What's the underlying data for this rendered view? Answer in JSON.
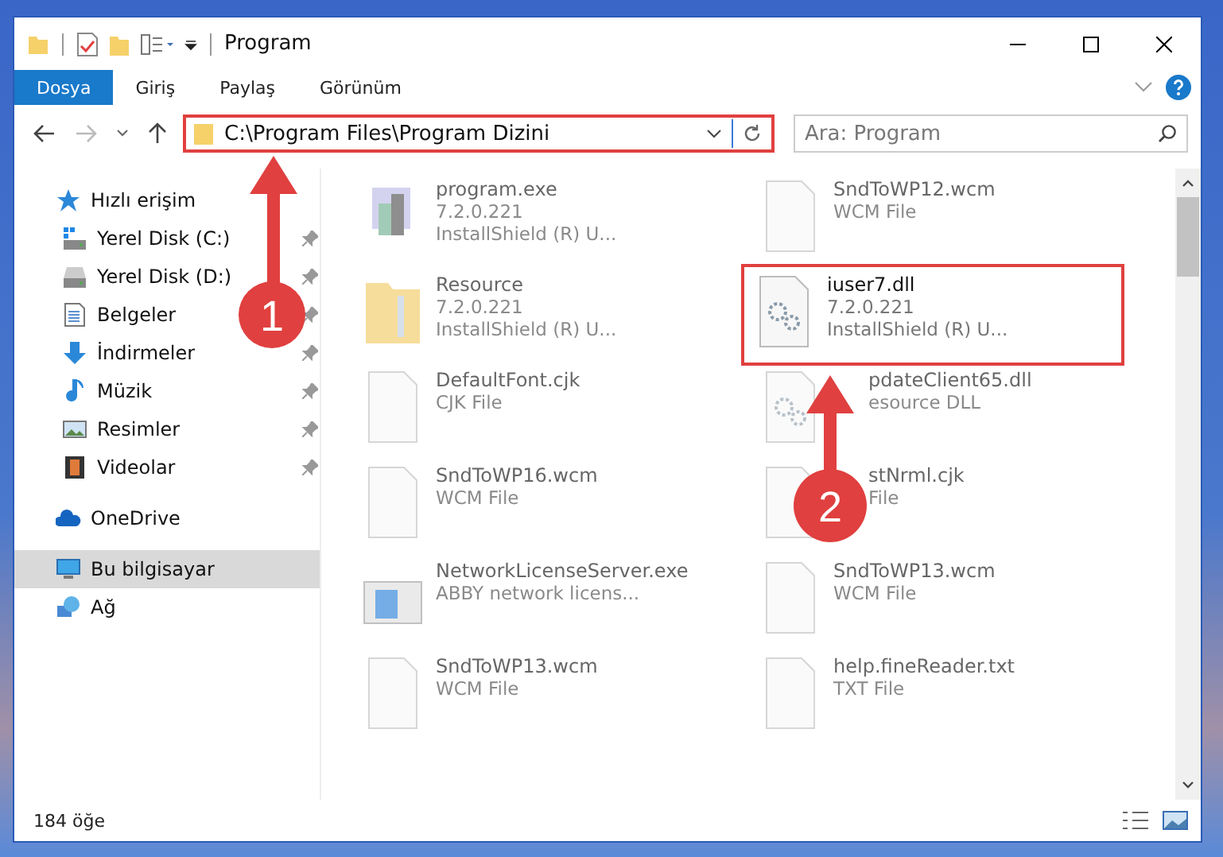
{
  "window": {
    "title": "Program"
  },
  "ribbon_tabs": [
    {
      "label": "Dosya",
      "selected": true
    },
    {
      "label": "Giriş",
      "selected": false
    },
    {
      "label": "Paylaş",
      "selected": false
    },
    {
      "label": "Görünüm",
      "selected": false
    }
  ],
  "address": {
    "path": "C:\\Program Files\\Program Dizini",
    "highlighted": true
  },
  "search": {
    "placeholder": "Ara: Program"
  },
  "sidebar": {
    "items": [
      {
        "label": "Hızlı erişim",
        "kind": "star",
        "selected": false,
        "children": [
          {
            "label": "Yerel Disk (C:)",
            "kind": "drive-c",
            "pinned": true,
            "selected": false
          },
          {
            "label": "Yerel Disk (D:)",
            "kind": "drive",
            "pinned": true,
            "selected": false
          },
          {
            "label": "Belgeler",
            "kind": "document",
            "pinned": true,
            "selected": false
          },
          {
            "label": "İndirmeler",
            "kind": "download",
            "pinned": true,
            "selected": false
          },
          {
            "label": "Müzik",
            "kind": "music",
            "pinned": true,
            "selected": false
          },
          {
            "label": "Resimler",
            "kind": "pictures",
            "pinned": true,
            "selected": false
          },
          {
            "label": "Videolar",
            "kind": "video",
            "pinned": true,
            "selected": false
          }
        ]
      },
      {
        "label": "OneDrive",
        "kind": "cloud",
        "selected": false
      },
      {
        "label": "Bu bilgisayar",
        "kind": "computer",
        "selected": true
      },
      {
        "label": "Ağ",
        "kind": "network",
        "selected": false
      }
    ]
  },
  "files": [
    {
      "name": "program.exe",
      "details": [
        "7.2.0.221",
        "InstallShield (R) U..."
      ],
      "kind": "exe",
      "highlighted": false
    },
    {
      "name": "SndToWP12.wcm",
      "details": [
        "WCM File"
      ],
      "kind": "file",
      "highlighted": false
    },
    {
      "name": "Resource",
      "details": [
        "7.2.0.221",
        "InstallShield (R) U..."
      ],
      "kind": "folder",
      "highlighted": false
    },
    {
      "name": "iuser7.dll",
      "details": [
        "7.2.0.221",
        "InstallShield (R) U..."
      ],
      "kind": "gear",
      "highlighted": true
    },
    {
      "name": "DefaultFont.cjk",
      "details": [
        "CJK File"
      ],
      "kind": "file",
      "highlighted": false
    },
    {
      "name": "pdateClient65.dll",
      "details": [
        "esource DLL"
      ],
      "kind": "dll",
      "highlighted": false,
      "covered": true
    },
    {
      "name": "SndToWP16.wcm",
      "details": [
        "WCM File"
      ],
      "kind": "file",
      "highlighted": false
    },
    {
      "name": "stNrml.cjk",
      "details": [
        "File"
      ],
      "kind": "file",
      "highlighted": false,
      "covered": true
    },
    {
      "name": "NetworkLicenseServer.exe",
      "details": [
        "ABBY network licens..."
      ],
      "kind": "app",
      "highlighted": false
    },
    {
      "name": "SndToWP13.wcm",
      "details": [
        "WCM File"
      ],
      "kind": "file",
      "highlighted": false
    },
    {
      "name": "SndToWP13.wcm",
      "details": [
        "WCM File"
      ],
      "kind": "file",
      "highlighted": false
    },
    {
      "name": "help.fineReader.txt",
      "details": [
        "TXT File"
      ],
      "kind": "file",
      "highlighted": false
    }
  ],
  "status_bar": {
    "count": "184 öğe"
  },
  "annotations": [
    {
      "number": "1"
    },
    {
      "number": "2"
    }
  ]
}
